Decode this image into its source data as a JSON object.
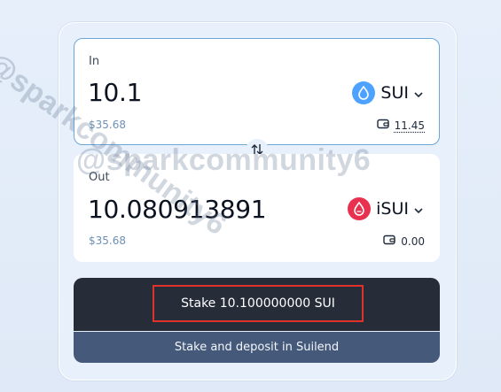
{
  "input": {
    "label": "In",
    "amount": "10.1",
    "usd": "$35.68",
    "token": "SUI",
    "balance": "11.45"
  },
  "output": {
    "label": "Out",
    "amount": "10.080913891",
    "usd": "$35.68",
    "token": "iSUI",
    "balance": "0.00"
  },
  "actions": {
    "stake_label": "Stake 10.100000000 SUI",
    "deposit_label": "Stake and deposit in Suilend"
  },
  "watermark": "@sparkcommunity6",
  "colors": {
    "sui": "#4da2ff",
    "isui": "#e8304f",
    "stake_bg": "#262c38",
    "deposit_bg": "#45597a",
    "highlight": "#e0312b"
  },
  "icons": [
    "sui-token-icon",
    "isui-token-icon",
    "chevron-down-icon",
    "wallet-icon",
    "swap-direction-icon"
  ]
}
